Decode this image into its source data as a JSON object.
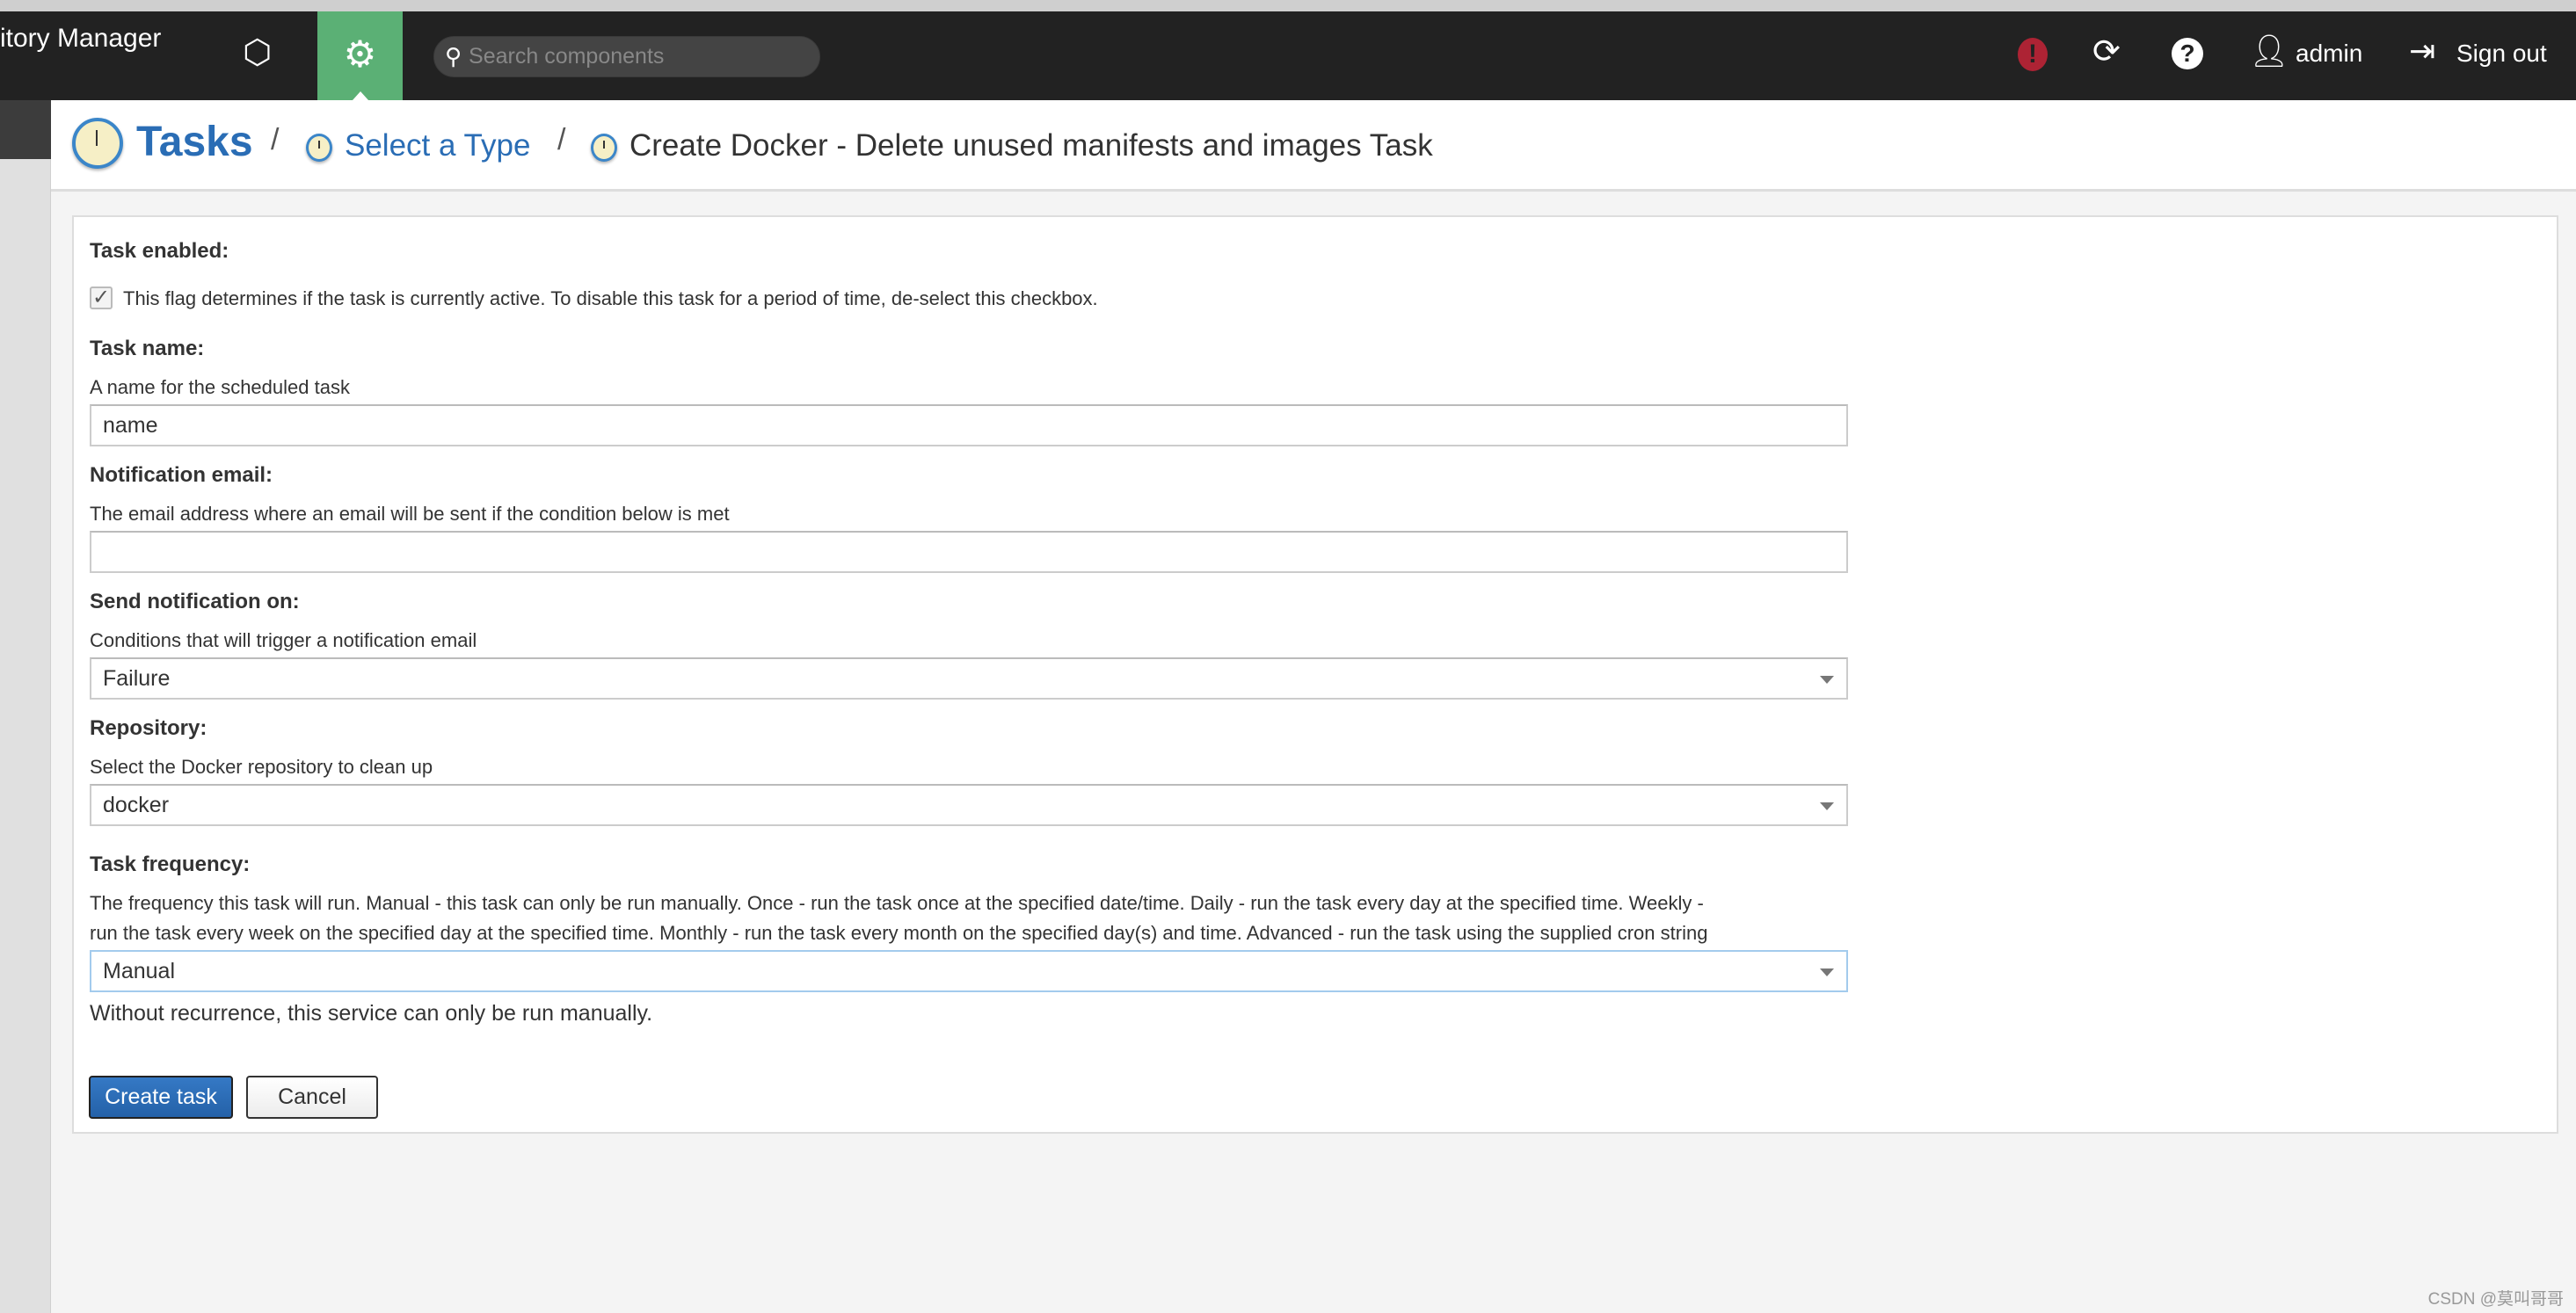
{
  "header": {
    "app_title": "itory Manager",
    "search_placeholder": "Search components",
    "user": "admin",
    "sign_out": "Sign out",
    "alert_color": "#ad2334",
    "active_tab_color": "#5bb075"
  },
  "breadcrumb": {
    "root": "Tasks",
    "separator": "/",
    "select_type": "Select a Type",
    "current": "Create Docker - Delete unused manifests and images Task"
  },
  "form": {
    "task_enabled": {
      "label": "Task enabled:",
      "help": "This flag determines if the task is currently active. To disable this task for a period of time, de-select this checkbox.",
      "checked": true
    },
    "task_name": {
      "label": "Task name:",
      "help": "A name for the scheduled task",
      "value": "name"
    },
    "notification_email": {
      "label": "Notification email:",
      "help": "The email address where an email will be sent if the condition below is met",
      "value": ""
    },
    "send_notification_on": {
      "label": "Send notification on:",
      "help": "Conditions that will trigger a notification email",
      "value": "Failure"
    },
    "repository": {
      "label": "Repository:",
      "help": "Select the Docker repository to clean up",
      "value": "docker"
    },
    "task_frequency": {
      "label": "Task frequency:",
      "help_line1": "The frequency this task will run. Manual - this task can only be run manually. Once - run the task once at the specified date/time. Daily - run the task every day at the specified time. Weekly -",
      "help_line2": "run the task every week on the specified day at the specified time. Monthly - run the task every month on the specified day(s) and time. Advanced - run the task using the supplied cron string",
      "value": "Manual",
      "note": "Without recurrence, this service can only be run manually."
    },
    "create_label": "Create task",
    "cancel_label": "Cancel"
  },
  "watermark": "CSDN @莫叫哥哥"
}
